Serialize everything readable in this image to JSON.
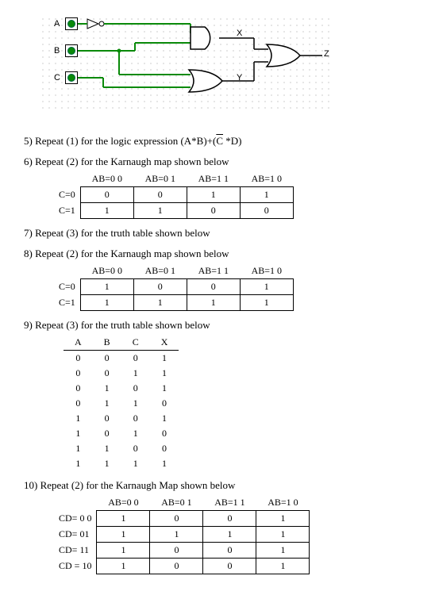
{
  "circuit": {
    "inputs": {
      "a": "A",
      "b": "B",
      "c": "C"
    },
    "outputs": {
      "x": "X",
      "y": "Y",
      "z": "Z"
    }
  },
  "q5": {
    "text": "5)  Repeat (1) for the logic expression (A*B)+(",
    "cbar": "C",
    "tail": " *D)"
  },
  "q6": {
    "text": "6)  Repeat (2) for the Karnaugh map shown below",
    "cols": [
      "AB=0 0",
      "AB=0 1",
      "AB=1 1",
      "AB=1 0"
    ],
    "rows": [
      {
        "hdr": "C=0",
        "cells": [
          "0",
          "0",
          "1",
          "1"
        ]
      },
      {
        "hdr": "C=1",
        "cells": [
          "1",
          "1",
          "0",
          "0"
        ]
      }
    ]
  },
  "q7": {
    "text": "7)  Repeat (3) for the  truth table shown below"
  },
  "q8": {
    "text": "8)  Repeat (2) for the Karnaugh map shown below",
    "cols": [
      "AB=0 0",
      "AB=0 1",
      "AB=1 1",
      "AB=1 0"
    ],
    "rows": [
      {
        "hdr": "C=0",
        "cells": [
          "1",
          "0",
          "0",
          "1"
        ]
      },
      {
        "hdr": "C=1",
        "cells": [
          "1",
          "1",
          "1",
          "1"
        ]
      }
    ]
  },
  "q9": {
    "text": "9)  Repeat (3) for the  truth table shown below",
    "headers": [
      "A",
      "B",
      "C",
      "X"
    ],
    "rows": [
      [
        "0",
        "0",
        "0",
        "1"
      ],
      [
        "0",
        "0",
        "1",
        "1"
      ],
      [
        "0",
        "1",
        "0",
        "1"
      ],
      [
        "0",
        "1",
        "1",
        "0"
      ],
      [
        "1",
        "0",
        "0",
        "1"
      ],
      [
        "1",
        "0",
        "1",
        "0"
      ],
      [
        "1",
        "1",
        "0",
        "0"
      ],
      [
        "1",
        "1",
        "1",
        "1"
      ]
    ]
  },
  "q10": {
    "text": "10)  Repeat (2) for the Karnaugh Map shown below",
    "cols": [
      "AB=0 0",
      "AB=0 1",
      "AB=1 1",
      "AB=1 0"
    ],
    "rows": [
      {
        "hdr": "CD= 0 0",
        "cells": [
          "1",
          "0",
          "0",
          "1"
        ]
      },
      {
        "hdr": "CD= 01",
        "cells": [
          "1",
          "1",
          "1",
          "1"
        ]
      },
      {
        "hdr": "CD= 11",
        "cells": [
          "1",
          "0",
          "0",
          "1"
        ]
      },
      {
        "hdr": "CD = 10",
        "cells": [
          "1",
          "0",
          "0",
          "1"
        ]
      }
    ]
  }
}
